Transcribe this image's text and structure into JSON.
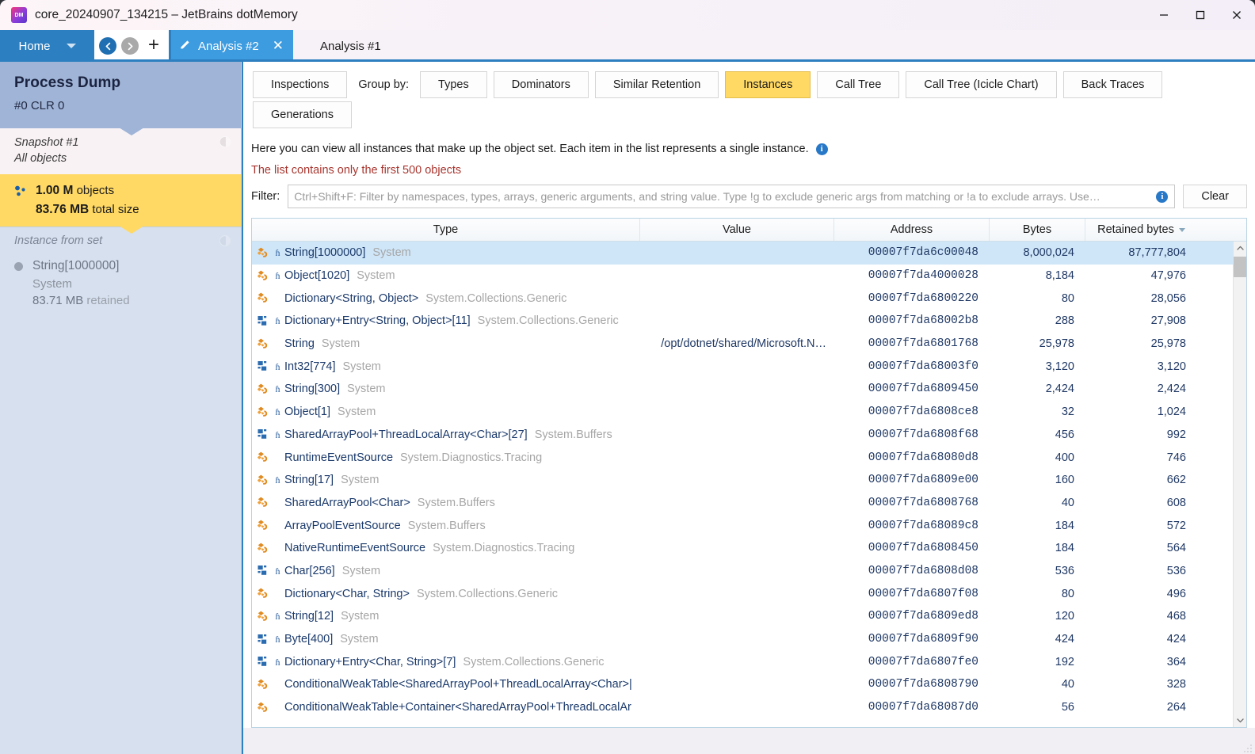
{
  "window": {
    "title": "core_20240907_134215 – JetBrains dotMemory",
    "app_icon": "dotmemory-icon",
    "minimize": "–",
    "maximize": "□",
    "close": "✕"
  },
  "tabbar": {
    "home_label": "Home",
    "back_icon": "back-arrow-icon",
    "forward_icon": "forward-arrow-icon",
    "add_label": "+",
    "active_tab": "Analysis #2",
    "active_tab_close": "✕",
    "inactive_tab": "Analysis #1"
  },
  "sidebar": {
    "process": {
      "title": "Process Dump",
      "subtitle": "#0 CLR 0"
    },
    "snapshot": {
      "line1": "Snapshot #1",
      "line2": "All objects",
      "objects_count": "1.00 M",
      "objects_label": "objects",
      "total_size": "83.76 MB",
      "total_size_label": "total size"
    },
    "instance": {
      "header": "Instance from set",
      "type": "String[1000000]",
      "namespace": "System",
      "retained_value": "83.71 MB",
      "retained_label": "retained"
    }
  },
  "view_tabs": {
    "inspections": "Inspections",
    "group_by_label": "Group by:",
    "items": [
      {
        "label": "Types",
        "selected": false
      },
      {
        "label": "Dominators",
        "selected": false
      },
      {
        "label": "Similar Retention",
        "selected": false
      },
      {
        "label": "Instances",
        "selected": true
      },
      {
        "label": "Call Tree",
        "selected": false
      },
      {
        "label": "Call Tree (Icicle Chart)",
        "selected": false
      },
      {
        "label": "Back Traces",
        "selected": false
      }
    ],
    "generations": "Generations"
  },
  "hint": "Here you can view all instances that make up the object set. Each item in the list represents a single instance.",
  "limit_note": "The list contains only the first 500 objects",
  "filter": {
    "label": "Filter:",
    "value": "",
    "placeholder": "Ctrl+Shift+F: Filter by namespaces, types, arrays, generic arguments, and string value. Type !g to exclude generic args from matching or !a to exclude arrays. Use…",
    "clear_label": "Clear"
  },
  "grid": {
    "columns": [
      {
        "key": "type",
        "label": "Type"
      },
      {
        "key": "value",
        "label": "Value"
      },
      {
        "key": "addr",
        "label": "Address"
      },
      {
        "key": "bytes",
        "label": "Bytes"
      },
      {
        "key": "ret",
        "label": "Retained bytes",
        "sorted": true,
        "sort_dir": "desc"
      }
    ],
    "rows": [
      {
        "icon": "class-icon",
        "arr": true,
        "type": "String[1000000]",
        "ns": "System",
        "value": "",
        "addr": "00007f7da6c00048",
        "bytes": "8,000,024",
        "ret": "87,777,804",
        "selected": true
      },
      {
        "icon": "class-icon",
        "arr": true,
        "type": "Object[1020]",
        "ns": "System",
        "value": "",
        "addr": "00007f7da4000028",
        "bytes": "8,184",
        "ret": "47,976",
        "selected": false
      },
      {
        "icon": "class-icon",
        "arr": false,
        "type": "Dictionary<String, Object>",
        "ns": "System.Collections.Generic",
        "value": "",
        "addr": "00007f7da6800220",
        "bytes": "80",
        "ret": "28,056",
        "selected": false
      },
      {
        "icon": "struct-icon",
        "arr": true,
        "type": "Dictionary+Entry<String, Object>[11]",
        "ns": "System.Collections.Generic",
        "value": "",
        "addr": "00007f7da68002b8",
        "bytes": "288",
        "ret": "27,908",
        "selected": false
      },
      {
        "icon": "class-icon",
        "arr": false,
        "type": "String",
        "ns": "System",
        "value": "/opt/dotnet/shared/Microsoft.N…",
        "addr": "00007f7da6801768",
        "bytes": "25,978",
        "ret": "25,978",
        "selected": false
      },
      {
        "icon": "struct-icon",
        "arr": true,
        "type": "Int32[774]",
        "ns": "System",
        "value": "",
        "addr": "00007f7da68003f0",
        "bytes": "3,120",
        "ret": "3,120",
        "selected": false
      },
      {
        "icon": "class-icon",
        "arr": true,
        "type": "String[300]",
        "ns": "System",
        "value": "",
        "addr": "00007f7da6809450",
        "bytes": "2,424",
        "ret": "2,424",
        "selected": false
      },
      {
        "icon": "class-icon",
        "arr": true,
        "type": "Object[1]",
        "ns": "System",
        "value": "",
        "addr": "00007f7da6808ce8",
        "bytes": "32",
        "ret": "1,024",
        "selected": false
      },
      {
        "icon": "struct-icon",
        "arr": true,
        "type": "SharedArrayPool+ThreadLocalArray<Char>[27]",
        "ns": "System.Buffers",
        "value": "",
        "addr": "00007f7da6808f68",
        "bytes": "456",
        "ret": "992",
        "selected": false
      },
      {
        "icon": "class-icon",
        "arr": false,
        "type": "RuntimeEventSource",
        "ns": "System.Diagnostics.Tracing",
        "value": "",
        "addr": "00007f7da68080d8",
        "bytes": "400",
        "ret": "746",
        "selected": false
      },
      {
        "icon": "class-icon",
        "arr": true,
        "type": "String[17]",
        "ns": "System",
        "value": "",
        "addr": "00007f7da6809e00",
        "bytes": "160",
        "ret": "662",
        "selected": false
      },
      {
        "icon": "class-icon",
        "arr": false,
        "type": "SharedArrayPool<Char>",
        "ns": "System.Buffers",
        "value": "",
        "addr": "00007f7da6808768",
        "bytes": "40",
        "ret": "608",
        "selected": false
      },
      {
        "icon": "class-icon",
        "arr": false,
        "type": "ArrayPoolEventSource",
        "ns": "System.Buffers",
        "value": "",
        "addr": "00007f7da68089c8",
        "bytes": "184",
        "ret": "572",
        "selected": false
      },
      {
        "icon": "class-icon",
        "arr": false,
        "type": "NativeRuntimeEventSource",
        "ns": "System.Diagnostics.Tracing",
        "value": "",
        "addr": "00007f7da6808450",
        "bytes": "184",
        "ret": "564",
        "selected": false
      },
      {
        "icon": "struct-icon",
        "arr": true,
        "type": "Char[256]",
        "ns": "System",
        "value": "",
        "addr": "00007f7da6808d08",
        "bytes": "536",
        "ret": "536",
        "selected": false
      },
      {
        "icon": "class-icon",
        "arr": false,
        "type": "Dictionary<Char, String>",
        "ns": "System.Collections.Generic",
        "value": "",
        "addr": "00007f7da6807f08",
        "bytes": "80",
        "ret": "496",
        "selected": false
      },
      {
        "icon": "class-icon",
        "arr": true,
        "type": "String[12]",
        "ns": "System",
        "value": "",
        "addr": "00007f7da6809ed8",
        "bytes": "120",
        "ret": "468",
        "selected": false
      },
      {
        "icon": "struct-icon",
        "arr": true,
        "type": "Byte[400]",
        "ns": "System",
        "value": "",
        "addr": "00007f7da6809f90",
        "bytes": "424",
        "ret": "424",
        "selected": false
      },
      {
        "icon": "struct-icon",
        "arr": true,
        "type": "Dictionary+Entry<Char, String>[7]",
        "ns": "System.Collections.Generic",
        "value": "",
        "addr": "00007f7da6807fe0",
        "bytes": "192",
        "ret": "364",
        "selected": false
      },
      {
        "icon": "class-icon",
        "arr": false,
        "type": "ConditionalWeakTable<SharedArrayPool+ThreadLocalArray<Char>|",
        "ns": "",
        "value": "",
        "addr": "00007f7da6808790",
        "bytes": "40",
        "ret": "328",
        "selected": false
      },
      {
        "icon": "class-icon",
        "arr": false,
        "type": "ConditionalWeakTable+Container<SharedArrayPool+ThreadLocalAr",
        "ns": "",
        "value": "",
        "addr": "00007f7da68087d0",
        "bytes": "56",
        "ret": "264",
        "selected": false
      }
    ],
    "scrollbar": {
      "up": "▲",
      "down": "▼"
    }
  },
  "colors": {
    "accent_blue": "#2c7fc0",
    "tab_blue": "#3d9be0",
    "highlight_yellow": "#ffd964",
    "selection_blue": "#cfe6f8",
    "warning_red": "#a8352e",
    "class_icon_orange": "#e08b22",
    "struct_icon_blue": "#2b6cb0"
  }
}
